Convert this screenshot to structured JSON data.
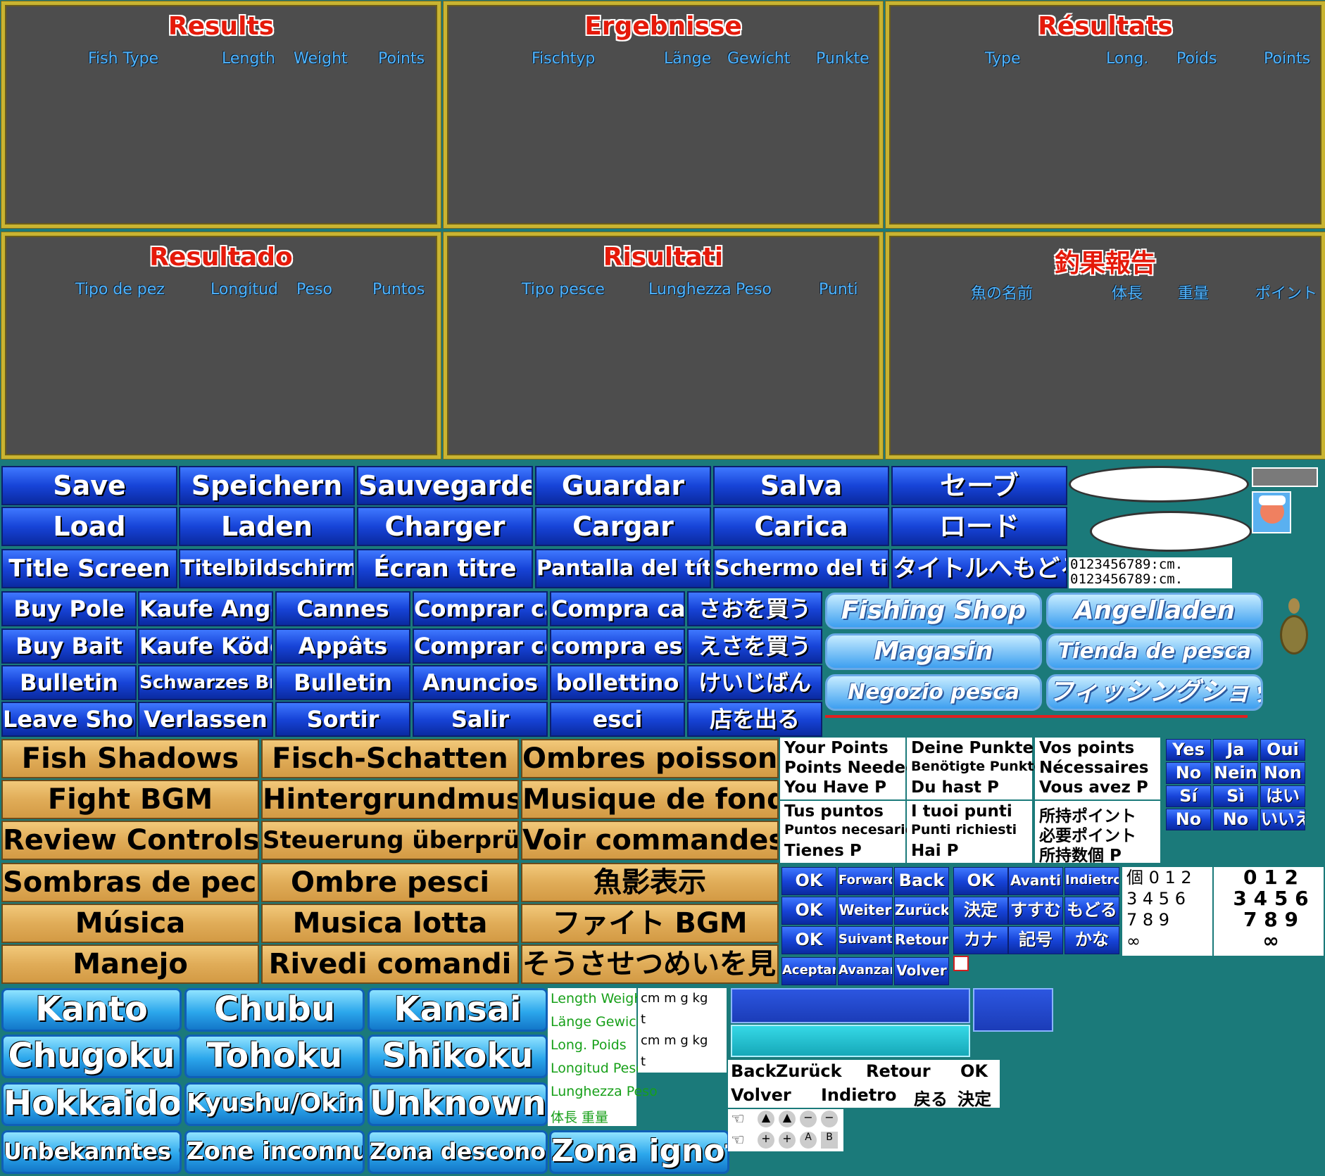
{
  "results_panels": [
    {
      "title": "Results",
      "headers": [
        "Fish Type",
        "Length",
        "Weight",
        "Points"
      ]
    },
    {
      "title": "Ergebnisse",
      "headers": [
        "Fischtyp",
        "Länge",
        "Gewicht",
        "Punkte"
      ]
    },
    {
      "title": "Résultats",
      "headers": [
        "Type",
        "Long.",
        "Poids",
        "Points"
      ]
    },
    {
      "title": "Resultado",
      "headers": [
        "Tipo de pez",
        "Longitud",
        "Peso",
        "Puntos"
      ]
    },
    {
      "title": "Risultati",
      "headers": [
        "Tipo pesce",
        "Lunghezza",
        "Peso",
        "Punti"
      ]
    },
    {
      "title": "釣果報告",
      "headers": [
        "魚の名前",
        "体長",
        "重量",
        "ポイント"
      ]
    }
  ],
  "menu_rows": [
    [
      "Save",
      "Speichern",
      "Sauvegarder",
      "Guardar",
      "Salva",
      "セーブ"
    ],
    [
      "Load",
      "Laden",
      "Charger",
      "Cargar",
      "Carica",
      "ロード"
    ],
    [
      "Title Screen",
      "Titelbildschirm",
      "Écran titre",
      "Pantalla del título",
      "Schermo del titolo",
      "タイトルへもどる"
    ]
  ],
  "digits_rows": [
    "0123456789:cm.",
    "0123456789:cm."
  ],
  "shop_rows": [
    [
      "Buy Pole",
      "Kaufe Angel",
      "Cannes",
      "Comprar caña",
      "Compra canna",
      "さおを買う"
    ],
    [
      "Buy Bait",
      "Kaufe Köder",
      "Appâts",
      "Comprar cebo",
      "compra esca",
      "えさを買う"
    ],
    [
      "Bulletin",
      "Schwarzes Brett",
      "Bulletin",
      "Anuncios",
      "bollettino",
      "けいじばん"
    ],
    [
      "Leave Shop",
      "Verlassen",
      "Sortir",
      "Salir",
      "esci",
      "店を出る"
    ]
  ],
  "shop_banners": [
    "Fishing Shop",
    "Angelladen",
    "Magasin",
    "Tienda de pesca",
    "Negozio pesca",
    "フィッシングショップ"
  ],
  "option_rows": [
    [
      "Fish Shadows",
      "Fisch-Schatten",
      "Ombres poissons"
    ],
    [
      "Fight BGM",
      "Hintergrundmusik",
      "Musique de fond"
    ],
    [
      "Review Controls",
      "Steuerung überprüfen",
      "Voir commandes"
    ],
    [
      "Sombras de peces",
      "Ombre pesci",
      "魚影表示"
    ],
    [
      "Música",
      "Musica lotta",
      "ファイト BGM"
    ],
    [
      "Manejo",
      "Rivedi comandi",
      "そうさせつめいを見る"
    ]
  ],
  "points_boxes": [
    [
      "Your Points",
      "Points Needed",
      "You Have  P"
    ],
    [
      "Deine Punkte",
      "Benötigte Punkte",
      "Du hast   P"
    ],
    [
      "Vos points",
      "Nécessaires",
      "Vous avez P"
    ],
    [
      "Tus puntos",
      "Puntos necesarios",
      "Tienes     P"
    ],
    [
      "I tuoi punti",
      "Punti richiesti",
      "Hai          P"
    ],
    [
      "所持ポイント",
      "必要ポイント",
      "所持数個 P"
    ]
  ],
  "yes_no": [
    [
      "Yes",
      "Ja",
      "Oui"
    ],
    [
      "No",
      "Nein",
      "Non"
    ],
    [
      "Sí",
      "Sì",
      "はい"
    ],
    [
      "No",
      "No",
      "いいえ"
    ]
  ],
  "nav_rows": [
    [
      "OK",
      "Forward",
      "Back",
      "OK",
      "Avanti",
      "Indietro"
    ],
    [
      "OK",
      "Weiter",
      "Zurück",
      "決定",
      "すすむ",
      "もどる"
    ],
    [
      "OK",
      "Suivant",
      "Retour",
      "カナ",
      "記号",
      "かな"
    ],
    [
      "Aceptar",
      "Avanzar",
      "Volver"
    ]
  ],
  "counter_small": [
    "個 0 1 2",
    "3 4 5 6",
    "7 8 9",
    "∞"
  ],
  "counter_large": [
    "0 1 2",
    "3 4 5 6",
    "7 8 9",
    "∞"
  ],
  "regions": [
    [
      "Kanto",
      "Chubu",
      "Kansai"
    ],
    [
      "Chugoku",
      "Tohoku",
      "Shikoku"
    ],
    [
      "Hokkaido",
      "Kyushu/Okinawa",
      "Unknown Area"
    ],
    [
      "Unbekanntes Gebiet",
      "Zone inconnue",
      "Zona desconocida",
      "Zona ignota"
    ]
  ],
  "measure_labels": [
    "Length Weight",
    "Länge Gewicht",
    "Long.  Poids",
    "Longitud  Peso",
    "Lunghezza  Peso",
    "体長  重量"
  ],
  "units": [
    "cm m  g kg",
    "t",
    "cm m  g kg",
    "t"
  ],
  "back_row1": [
    "Back",
    "Zurück",
    "Retour",
    "OK"
  ],
  "back_row2": [
    "Volver",
    "Indietro",
    "戻る",
    "決定"
  ],
  "colors": {
    "background": "#1b7a7a",
    "panel": "#4d4d4d",
    "panel_border": "#c9b431",
    "title_red": "#e51a0a",
    "header_blue": "#4fb4ff"
  }
}
